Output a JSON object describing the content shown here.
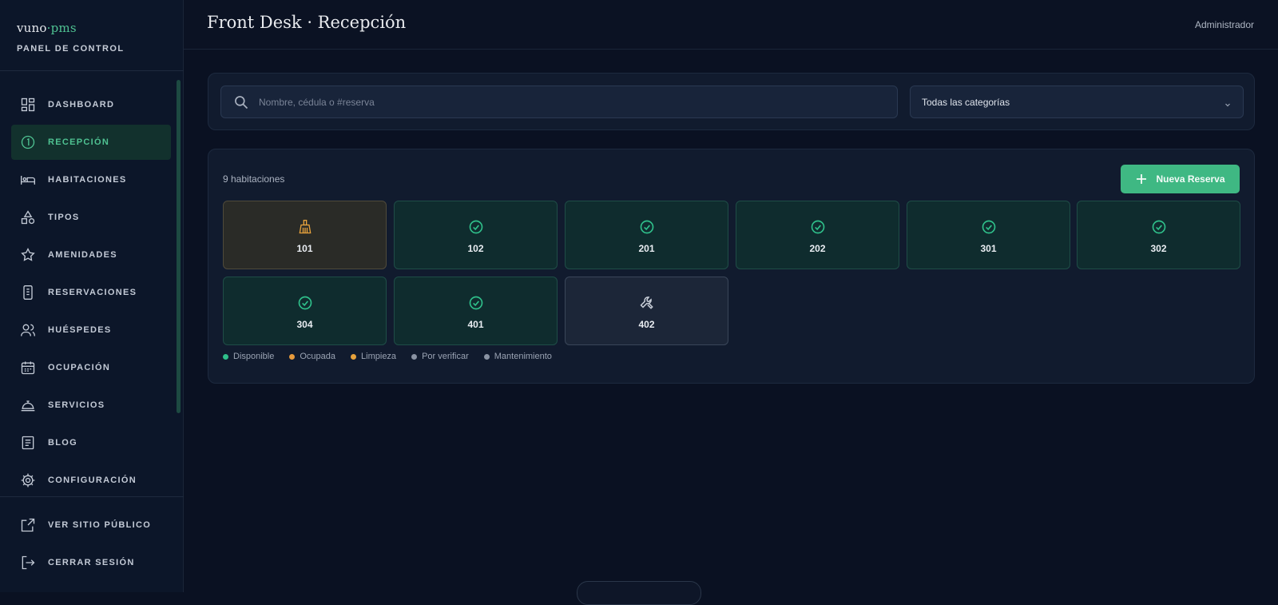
{
  "brand": {
    "name": "vuno",
    "separator": "·",
    "suffix": "pms",
    "subtitle": "PANEL DE CONTROL"
  },
  "sidebar": {
    "items": [
      {
        "label": "DASHBOARD",
        "icon": "dashboard-icon",
        "active": false
      },
      {
        "label": "RECEPCIÓN",
        "icon": "reception-icon",
        "active": true
      },
      {
        "label": "HABITACIONES",
        "icon": "bed-icon",
        "active": false
      },
      {
        "label": "TIPOS",
        "icon": "shapes-icon",
        "active": false
      },
      {
        "label": "AMENIDADES",
        "icon": "star-icon",
        "active": false
      },
      {
        "label": "RESERVACIONES",
        "icon": "reservation-icon",
        "active": false
      },
      {
        "label": "HUÉSPEDES",
        "icon": "guests-icon",
        "active": false
      },
      {
        "label": "OCUPACIÓN",
        "icon": "calendar-icon",
        "active": false
      },
      {
        "label": "SERVICIOS",
        "icon": "service-bell-icon",
        "active": false
      },
      {
        "label": "BLOG",
        "icon": "blog-icon",
        "active": false
      },
      {
        "label": "CONFIGURACIÓN",
        "icon": "gear-icon",
        "active": false
      }
    ],
    "bottom_items": [
      {
        "label": "VER SITIO PÚBLICO",
        "icon": "external-link-icon"
      },
      {
        "label": "CERRAR SESIÓN",
        "icon": "logout-icon"
      }
    ]
  },
  "header": {
    "title": "Front Desk · Recepción",
    "user": "Administrador"
  },
  "search": {
    "placeholder": "Nombre, cédula o #reserva",
    "value": ""
  },
  "category_filter": {
    "selected": "Todas las categorías"
  },
  "rooms": {
    "count_label": "9 habitaciones",
    "new_button_label": "Nueva Reserva",
    "items": [
      {
        "number": "101",
        "status": "cleaning",
        "icon": "broom-icon"
      },
      {
        "number": "102",
        "status": "available",
        "icon": "check-circle-icon"
      },
      {
        "number": "201",
        "status": "available",
        "icon": "check-circle-icon"
      },
      {
        "number": "202",
        "status": "available",
        "icon": "check-circle-icon"
      },
      {
        "number": "301",
        "status": "available",
        "icon": "check-circle-icon"
      },
      {
        "number": "302",
        "status": "available",
        "icon": "check-circle-icon"
      },
      {
        "number": "304",
        "status": "available",
        "icon": "check-circle-icon"
      },
      {
        "number": "401",
        "status": "available",
        "icon": "check-circle-icon"
      },
      {
        "number": "402",
        "status": "maintenance",
        "icon": "wrench-icon"
      }
    ]
  },
  "legend": [
    {
      "label": "Disponible",
      "color": "#2fbf8a"
    },
    {
      "label": "Ocupada",
      "color": "#e79a3c"
    },
    {
      "label": "Limpieza",
      "color": "#e7a23c"
    },
    {
      "label": "Por verificar",
      "color": "#8a93a3"
    },
    {
      "label": "Mantenimiento",
      "color": "#8a93a3"
    }
  ],
  "colors": {
    "accent": "#3fb883",
    "available": "#2fbf8a",
    "cleaning": "#e7a23c",
    "maintenance": "#aab2c0"
  }
}
